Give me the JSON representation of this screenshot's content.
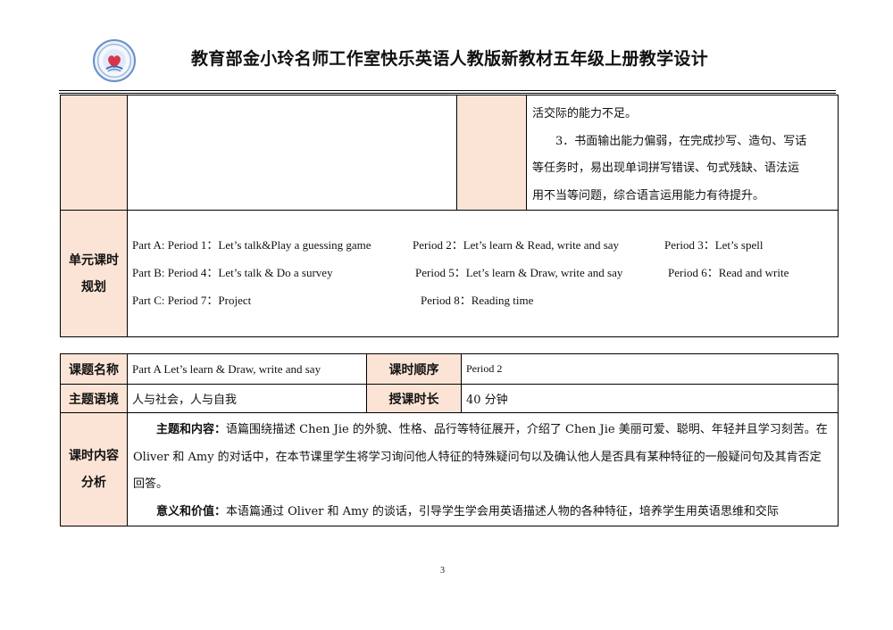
{
  "header": {
    "logo_icon": "teacher-studio-heart-logo",
    "title": "教育部金小玲名师工作室快乐英语人教版新教材五年级上册教学设计"
  },
  "continuation": {
    "lines": [
      "活交际的能力不足。",
      "3．书面输出能力偏弱，在完成抄写、造句、写话",
      "等任务时，易出现单词拼写错误、句式残缺、语法运",
      "用不当等问题，综合语言运用能力有待提升。"
    ]
  },
  "unit_plan": {
    "label_line1": "单元课时",
    "label_line2": "规划",
    "partA_p1": "Part A: Period 1：Let’s talk&Play a guessing game",
    "partA_p2": "Period 2：Let’s learn & Read, write and say",
    "partA_p3": "Period 3：Let’s spell",
    "partB_p4": "Part B: Period 4：Let’s talk & Do a survey",
    "partB_p5": "Period 5：Let’s learn & Draw, write and say",
    "partB_p6": "Period 6：Read and write",
    "partC_p7": "Part C: Period 7：Project",
    "partC_p8": "Period 8：Reading time"
  },
  "lesson": {
    "topic_label": "课题名称",
    "topic_value": "Part A Let’s learn & Draw, write and say",
    "order_label": "课时顺序",
    "order_value": "Period 2",
    "theme_label": "主题语境",
    "theme_value": "人与社会，人与自我",
    "duration_label": "授课时长",
    "duration_value": "40 分钟",
    "analysis_label_line1": "课时内容",
    "analysis_label_line2": "分析",
    "content_heading": "主题和内容：",
    "content_text": "语篇围绕描述 Chen Jie 的外貌、性格、品行等特征展开，介绍了 Chen Jie 美丽可爱、聪明、年轻并且学习刻苦。在 Oliver 和 Amy 的对话中，在本节课里学生将学习询问他人特征的特殊疑问句以及确认他人是否具有某种特征的一般疑问句及其肯否定回答。",
    "meaning_heading": "意义和价值：",
    "meaning_text": "本语篇通过 Oliver 和 Amy 的谈话，引导学生学会用英语描述人物的各种特征，培养学生用英语思维和交际"
  },
  "footer": {
    "page_number": "3"
  }
}
